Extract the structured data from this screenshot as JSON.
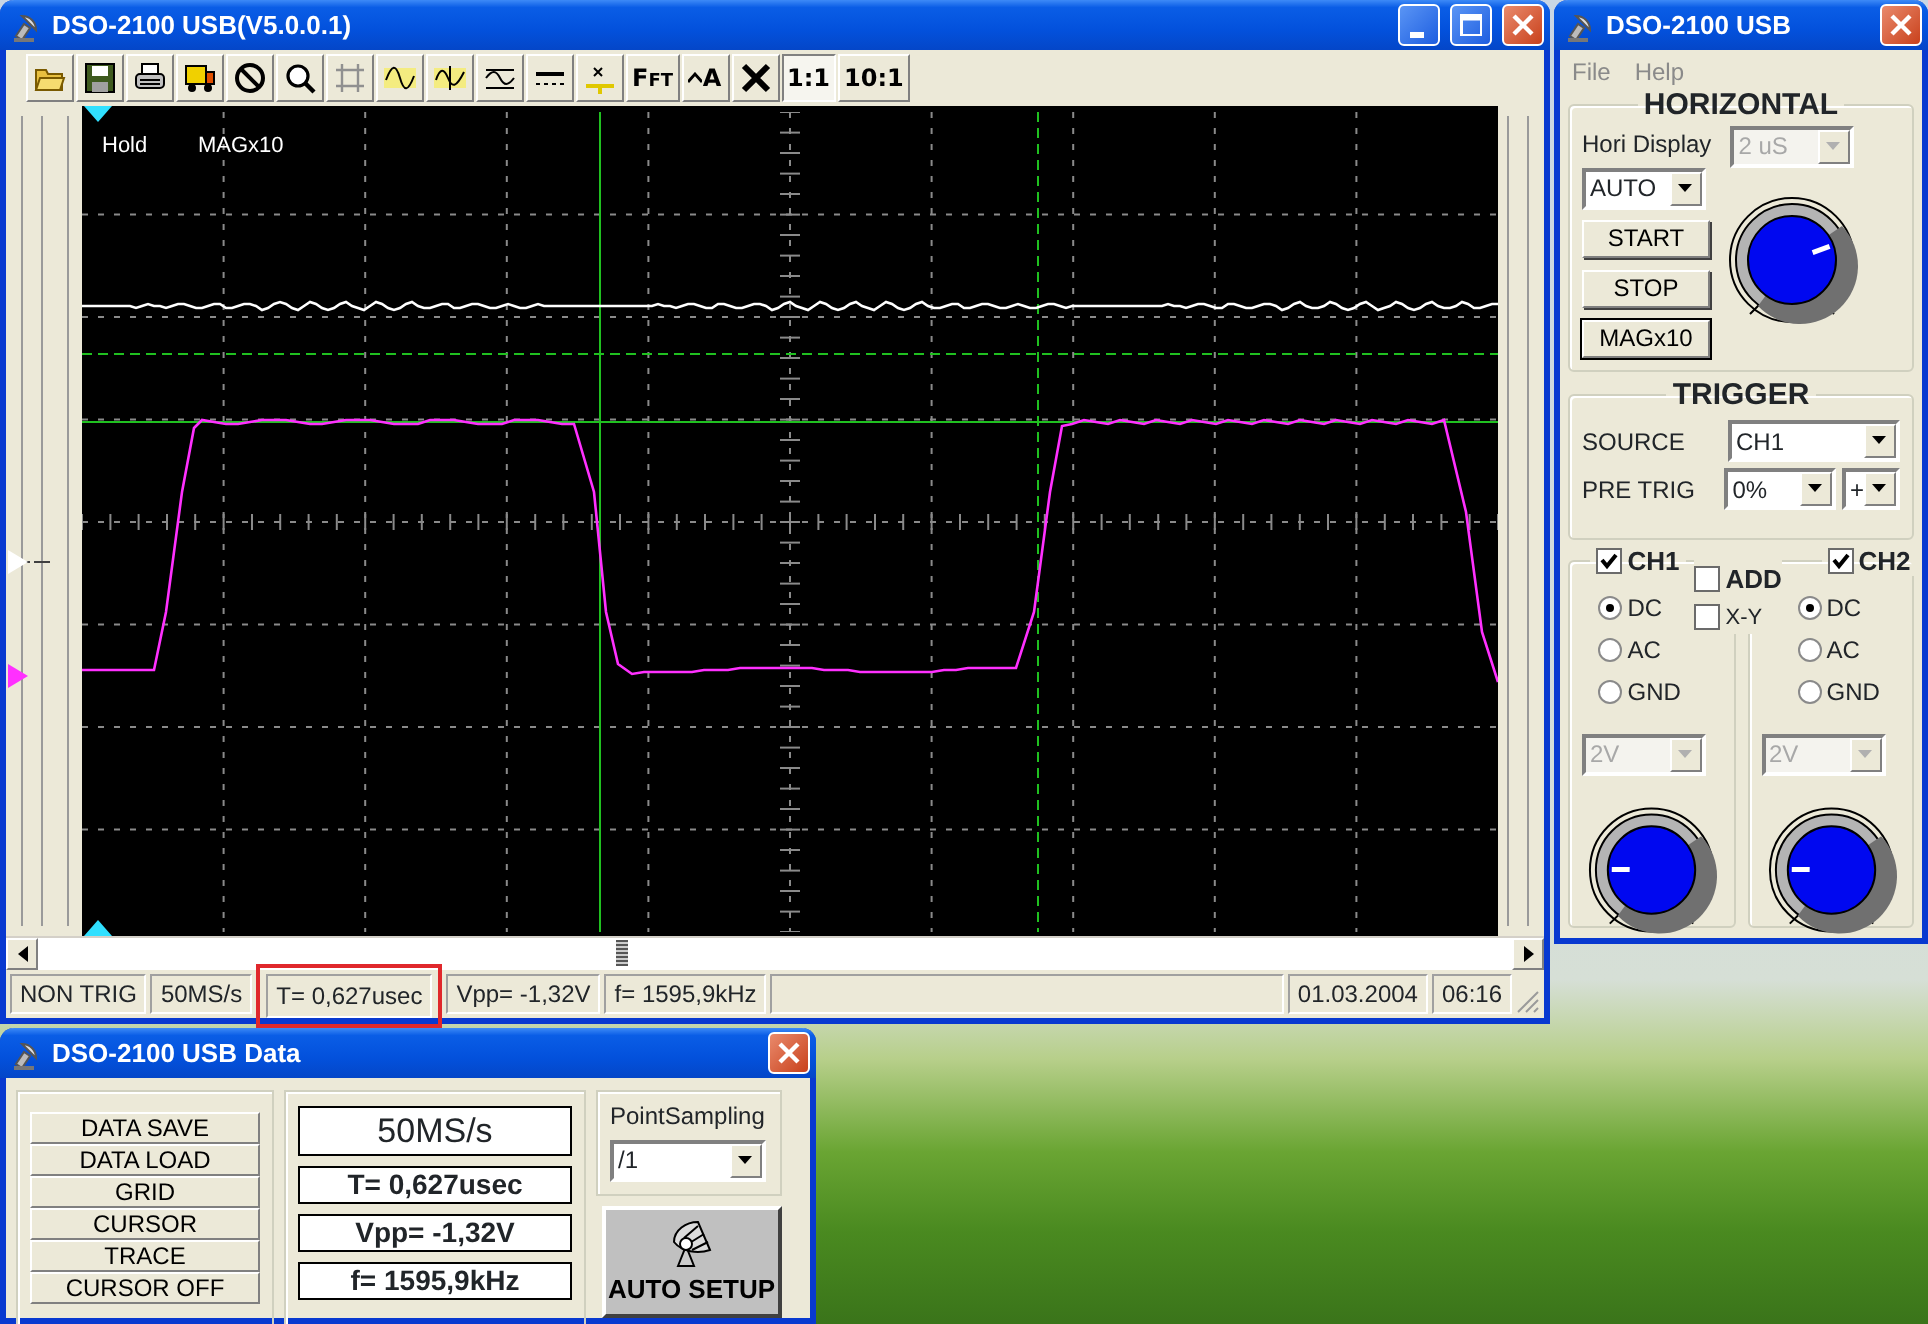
{
  "main_window": {
    "title": "DSO-2100 USB(V5.0.0.1)",
    "controls": [
      {
        "kind": "minimize"
      },
      {
        "kind": "maximize"
      },
      {
        "kind": "close"
      }
    ],
    "toolbar": [
      {
        "kind": "folder"
      },
      {
        "kind": "save"
      },
      {
        "kind": "print"
      },
      {
        "kind": "truck"
      },
      {
        "kind": "stop"
      },
      {
        "kind": "zoom"
      },
      {
        "kind": "grid"
      },
      {
        "kind": "sine"
      },
      {
        "kind": "phase"
      },
      {
        "kind": "filter"
      },
      {
        "kind": "dashes"
      },
      {
        "kind": "cursor"
      },
      {
        "kind": "text",
        "label": "F$_{F}$$_{T}$"
      },
      {
        "kind": "peak",
        "label": "A"
      },
      {
        "kind": "cross"
      },
      {
        "kind": "ratio",
        "label": "1:1",
        "selected": true
      },
      {
        "kind": "ratio",
        "label": "10:1",
        "selected": false
      }
    ],
    "screen": {
      "labels": [
        "Hold",
        "MAGx10"
      ]
    },
    "status_bar": {
      "left": [
        {
          "text": "NON TRIG",
          "highlighted": false
        },
        {
          "text": "50MS/s",
          "highlighted": false
        },
        {
          "text": "T= 0,627usec",
          "highlighted": true
        },
        {
          "text": "Vpp= -1,32V",
          "highlighted": false
        },
        {
          "text": "f= 1595,9kHz",
          "highlighted": false
        }
      ],
      "right": [
        {
          "text": "01.03.2004",
          "highlighted": false
        },
        {
          "text": "06:16",
          "highlighted": false
        }
      ]
    }
  },
  "control_window": {
    "title": "DSO-2100 USB",
    "controls": [
      {
        "kind": "close"
      }
    ],
    "menu": [
      "File",
      "Help"
    ],
    "horizontal": {
      "title": "HORIZONTAL",
      "display_label": "Hori Display",
      "mode": "AUTO",
      "timebase": {
        "value": "2 uS",
        "disabled": true
      },
      "buttons": [
        {
          "label": "START",
          "focused": false
        },
        {
          "label": "STOP",
          "focused": false
        },
        {
          "label": "MAGx10",
          "focused": true
        }
      ],
      "knob": {
        "level": 0.76
      }
    },
    "trigger": {
      "title": "TRIGGER",
      "source_label": "SOURCE",
      "source": "CH1",
      "pretrig_label": "PRE TRIG",
      "pretrig": "0%",
      "slope": "+"
    },
    "channels": [
      {
        "label": "CH1",
        "checked": true,
        "coupling": [
          {
            "label": "DC",
            "selected": true
          },
          {
            "label": "AC",
            "selected": false
          },
          {
            "label": "GND",
            "selected": false
          }
        ],
        "volts": {
          "value": "2V",
          "disabled": true
        },
        "knob": {
          "level": 0.17
        }
      },
      {
        "label": "CH2",
        "checked": true,
        "coupling": [
          {
            "label": "DC",
            "selected": true
          },
          {
            "label": "AC",
            "selected": false
          },
          {
            "label": "GND",
            "selected": false
          }
        ],
        "volts": {
          "value": "2V",
          "disabled": true
        },
        "knob": {
          "level": 0.17
        }
      }
    ],
    "add": {
      "label": "ADD",
      "checked": false
    },
    "xy": {
      "label": "X-Y",
      "checked": false
    }
  },
  "data_window": {
    "title": "DSO-2100 USB Data",
    "controls": [
      {
        "kind": "close"
      }
    ],
    "buttons": [
      "DATA SAVE",
      "DATA LOAD",
      "GRID",
      "CURSOR",
      "TRACE",
      "CURSOR OFF"
    ],
    "readouts": [
      {
        "text": "50MS/s",
        "kind": "large"
      },
      {
        "text": "T= 0,627usec",
        "kind": "bold"
      },
      {
        "text": "Vpp= -1,32V",
        "kind": "bold"
      },
      {
        "text": "f= 1595,9kHz",
        "kind": "bold"
      }
    ],
    "point_sampling": {
      "label": "PointSampling",
      "value": "/1"
    },
    "auto_setup": "AUTO SETUP"
  }
}
